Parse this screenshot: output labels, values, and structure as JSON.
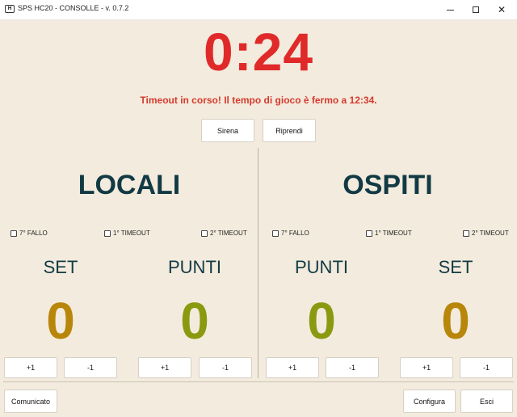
{
  "window": {
    "title": "SPS HC20 - CONSOLLE - v. 0.7.2",
    "icon": "app-icon"
  },
  "timer": {
    "value": "0:24",
    "color": "#e02a2a"
  },
  "status_message": "Timeout in corso! Il tempo di gioco è fermo a 12:34.",
  "controls": {
    "siren": "Sirena",
    "resume": "Riprendi"
  },
  "home": {
    "name": "LOCALI",
    "checkboxes": [
      {
        "label": "7° FALLO",
        "checked": false
      },
      {
        "label": "1° TIMEOUT",
        "checked": false
      },
      {
        "label": "2° TIMEOUT",
        "checked": false
      }
    ],
    "set": {
      "label": "SET",
      "value": "0",
      "color": "#b8860b"
    },
    "points": {
      "label": "PUNTI",
      "value": "0",
      "color": "#8a9a10"
    }
  },
  "away": {
    "name": "OSPITI",
    "checkboxes": [
      {
        "label": "7° FALLO",
        "checked": false
      },
      {
        "label": "1° TIMEOUT",
        "checked": false
      },
      {
        "label": "2° TIMEOUT",
        "checked": false
      }
    ],
    "points": {
      "label": "PUNTI",
      "value": "0",
      "color": "#8a9a10"
    },
    "set": {
      "label": "SET",
      "value": "0",
      "color": "#b8860b"
    }
  },
  "buttons": {
    "plus": "+1",
    "minus": "-1"
  },
  "footer": {
    "announcement": "Comunicato",
    "configure": "Configura",
    "exit": "Esci"
  }
}
